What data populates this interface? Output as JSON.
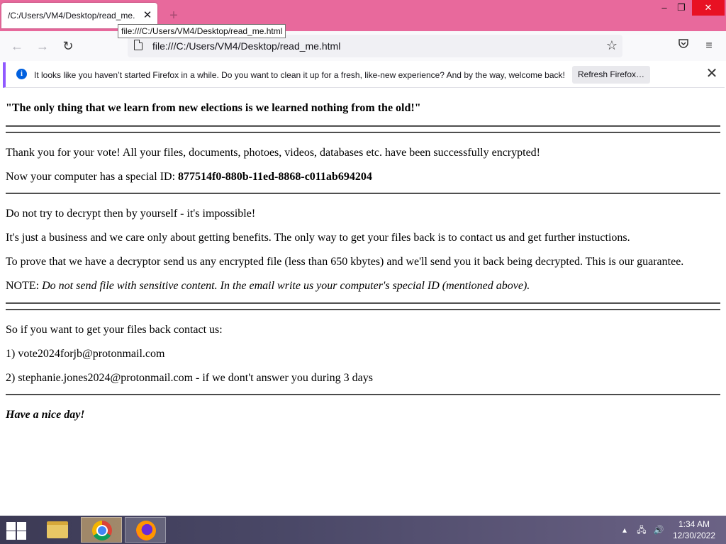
{
  "browser": {
    "tab_title": "/C:/Users/VM4/Desktop/read_me.html",
    "tooltip": "file:///C:/Users/VM4/Desktop/read_me.html",
    "url": "file:///C:/Users/VM4/Desktop/read_me.html",
    "icons": {
      "tab_close": "close-icon",
      "new_tab": "plus-icon",
      "back": "back-arrow-icon",
      "forward": "forward-arrow-icon",
      "reload": "reload-icon",
      "bookmark": "star-icon",
      "pocket": "pocket-icon",
      "menu": "hamburger-menu-icon"
    },
    "window_controls": {
      "minimize": "–",
      "restore": "❐",
      "close": "✕"
    }
  },
  "notification": {
    "text": "It looks like you haven’t started Firefox in a while. Do you want to clean it up for a fresh, like-new experience? And by the way, welcome back!",
    "button": "Refresh Firefox…"
  },
  "page": {
    "quote": "\"The only thing that we learn from new elections is we learned nothing from the old!\"",
    "thanks": "Thank you for your vote! All your files, documents, photoes, videos, databases etc. have been successfully encrypted!",
    "id_prefix": "Now your computer has a special ID: ",
    "id_value": "877514f0-880b-11ed-8868-c011ab694204",
    "p1": "Do not try to decrypt then by yourself - it's impossible!",
    "p2": "It's just a business and we care only about getting benefits. The only way to get your files back is to contact us and get further instuctions.",
    "p3": "To prove that we have a decryptor send us any encrypted file (less than 650 kbytes) and we'll send you it back being decrypted. This is our guarantee.",
    "note_label": "NOTE: ",
    "note_text": "Do not send file with sensitive content. In the email write us your computer's special ID (mentioned above).",
    "contact_intro": "So if you want to get your files back contact us:",
    "contact_1": "1) vote2024forjb@protonmail.com",
    "contact_2": "2) stephanie.jones2024@protonmail.com - if we dont't answer you during 3 days",
    "signoff": "Have a nice day!"
  },
  "taskbar": {
    "apps": [
      "file-explorer-icon",
      "chrome-icon",
      "firefox-icon"
    ],
    "time": "1:34 AM",
    "date": "12/30/2022"
  },
  "colors": {
    "titlebar": "#e8699c",
    "close_button": "#e81123",
    "notice_accent": "#9059ff",
    "info_icon": "#0060df"
  }
}
